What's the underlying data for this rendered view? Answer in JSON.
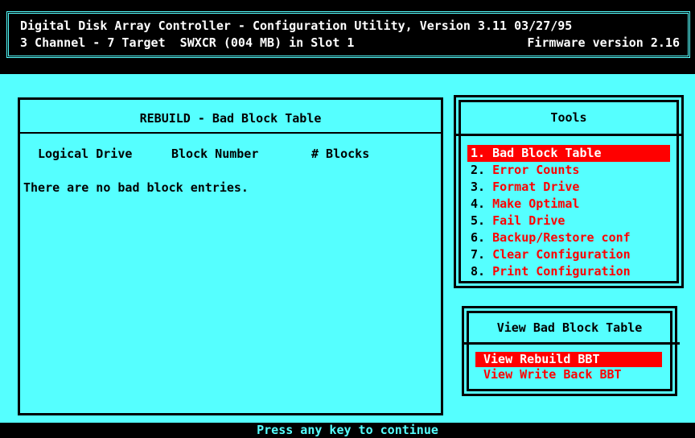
{
  "header": {
    "line1": "Digital Disk Array Controller - Configuration Utility, Version 3.11 03/27/95",
    "line2_left": "3 Channel - 7 Target  SWXCR (004 MB) in Slot 1",
    "line2_right": "Firmware version 2.16"
  },
  "rebuild_panel": {
    "title": "REBUILD - Bad Block Table",
    "col_logical_drive": "Logical Drive",
    "col_block_number": "Block Number",
    "col_blocks": "# Blocks",
    "message": "There are no bad block entries."
  },
  "tools": {
    "title": "Tools",
    "items": [
      {
        "num": "1.",
        "label": "Bad Block Table"
      },
      {
        "num": "2.",
        "label": "Error Counts"
      },
      {
        "num": "3.",
        "label": "Format Drive"
      },
      {
        "num": "4.",
        "label": "Make Optimal"
      },
      {
        "num": "5.",
        "label": "Fail Drive"
      },
      {
        "num": "6.",
        "label": "Backup/Restore conf"
      },
      {
        "num": "7.",
        "label": "Clear Configuration"
      },
      {
        "num": "8.",
        "label": "Print Configuration"
      }
    ],
    "selected_index": 0
  },
  "view_bbt": {
    "title": "View Bad Block Table",
    "items": [
      "View Rebuild BBT",
      "View Write Back BBT"
    ],
    "selected_index": 0
  },
  "status_bar": {
    "text": "Press any key to continue"
  }
}
